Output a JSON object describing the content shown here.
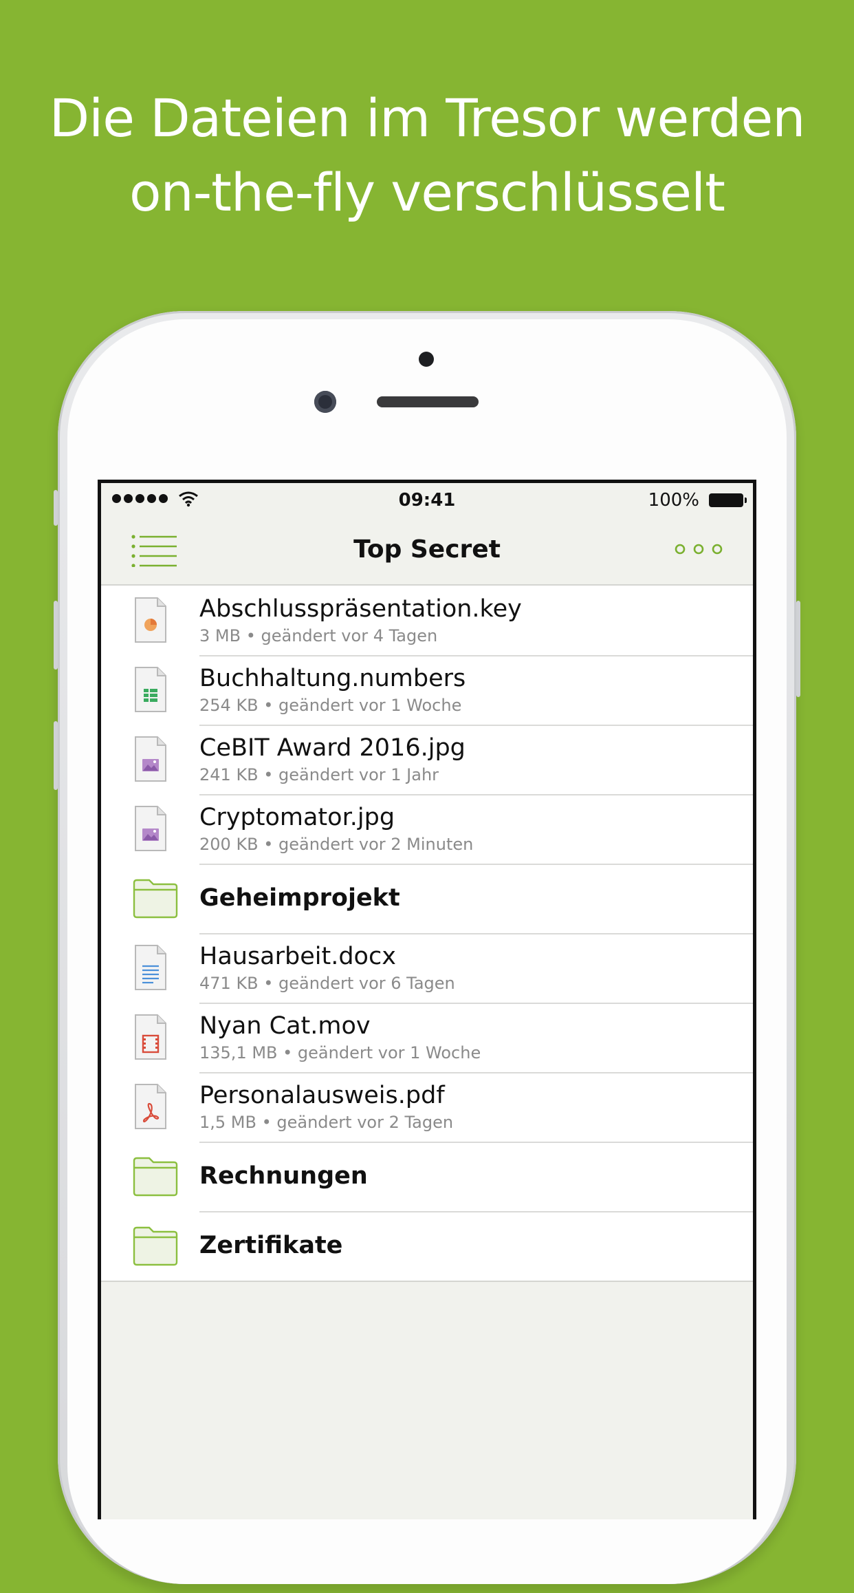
{
  "headline": {
    "line1": "Die Dateien im Tresor werden",
    "line2": "on-the-fly verschlüsselt"
  },
  "statusbar": {
    "time": "09:41",
    "battery": "100%"
  },
  "navbar": {
    "title": "Top Secret",
    "menu_icon": "list-icon",
    "more_icon": "ellipsis-icon"
  },
  "colors": {
    "background": "#86b532",
    "accent": "#7ab02f",
    "folder": "#8bbf3f"
  },
  "files": [
    {
      "type": "file",
      "icon": "presentation-file-icon",
      "name": "Abschlusspräsentation.key",
      "meta": "3 MB • geändert vor 4 Tagen"
    },
    {
      "type": "file",
      "icon": "spreadsheet-file-icon",
      "name": "Buchhaltung.numbers",
      "meta": "254 KB • geändert vor 1 Woche"
    },
    {
      "type": "file",
      "icon": "image-file-icon",
      "name": "CeBIT Award 2016.jpg",
      "meta": "241 KB • geändert vor 1 Jahr"
    },
    {
      "type": "file",
      "icon": "image-file-icon",
      "name": "Cryptomator.jpg",
      "meta": "200 KB • geändert vor 2 Minuten"
    },
    {
      "type": "folder",
      "icon": "folder-icon",
      "name": "Geheimprojekt"
    },
    {
      "type": "file",
      "icon": "text-file-icon",
      "name": "Hausarbeit.docx",
      "meta": "471 KB • geändert vor 6 Tagen"
    },
    {
      "type": "file",
      "icon": "video-file-icon",
      "name": "Nyan Cat.mov",
      "meta": "135,1 MB • geändert vor 1 Woche"
    },
    {
      "type": "file",
      "icon": "pdf-file-icon",
      "name": "Personalausweis.pdf",
      "meta": "1,5 MB • geändert vor 2 Tagen"
    },
    {
      "type": "folder",
      "icon": "folder-icon",
      "name": "Rechnungen"
    },
    {
      "type": "folder",
      "icon": "folder-icon",
      "name": "Zertifikate"
    }
  ]
}
